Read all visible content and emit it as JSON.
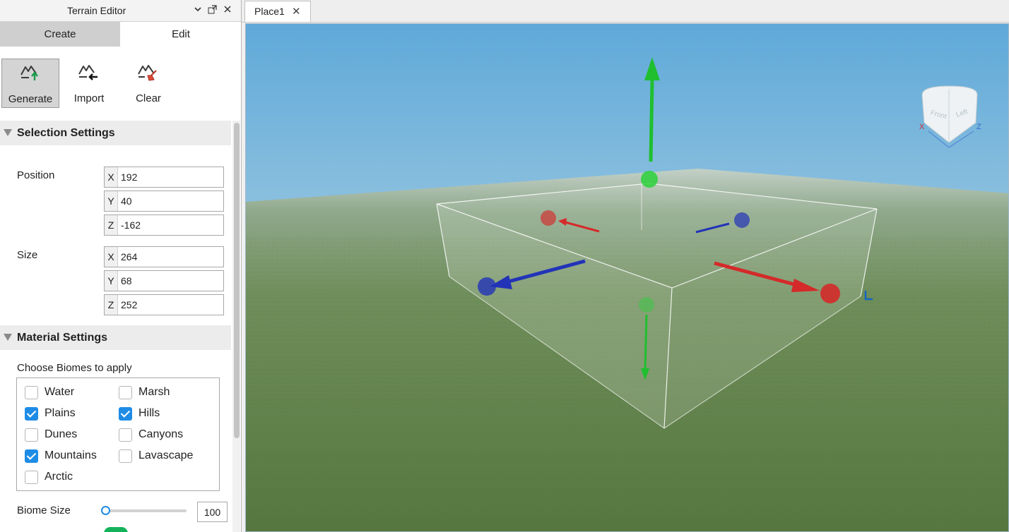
{
  "panel": {
    "title": "Terrain Editor",
    "titlebar_icons": [
      "chevron-down-icon",
      "undock-icon",
      "close-icon"
    ],
    "mode_tabs": {
      "create": "Create",
      "edit": "Edit",
      "active": "Create"
    },
    "tools": {
      "generate": "Generate",
      "import": "Import",
      "clear": "Clear",
      "active": "Generate"
    },
    "selection_settings": {
      "header": "Selection Settings",
      "position_label": "Position",
      "position": {
        "x": "192",
        "y": "40",
        "z": "-162"
      },
      "size_label": "Size",
      "size": {
        "x": "264",
        "y": "68",
        "z": "252"
      }
    },
    "material_settings": {
      "header": "Material Settings",
      "biomes_label": "Choose Biomes to apply",
      "biomes": [
        {
          "label": "Water",
          "checked": false
        },
        {
          "label": "Marsh",
          "checked": false
        },
        {
          "label": "Plains",
          "checked": true
        },
        {
          "label": "Hills",
          "checked": true
        },
        {
          "label": "Dunes",
          "checked": false
        },
        {
          "label": "Canyons",
          "checked": false
        },
        {
          "label": "Mountains",
          "checked": true
        },
        {
          "label": "Lavascape",
          "checked": false
        },
        {
          "label": "Arctic",
          "checked": false
        }
      ],
      "biome_size_label": "Biome Size",
      "biome_size_value": "100",
      "biome_size_fraction": 0.0
    },
    "axis_letters": {
      "x": "X",
      "y": "Y",
      "z": "Z"
    }
  },
  "document": {
    "tab_label": "Place1",
    "tab_close": "✕"
  },
  "viewport": {
    "view_cube_faces": {
      "front": "Front",
      "left": "Left"
    },
    "view_cube_axes": {
      "x": "X",
      "z": "Z"
    }
  },
  "colors": {
    "accent": "#1e8ce6",
    "toggle_on": "#14b35b",
    "handle_red": "#d42a2a",
    "handle_green": "#1fbf2f",
    "handle_blue": "#2233b8"
  }
}
